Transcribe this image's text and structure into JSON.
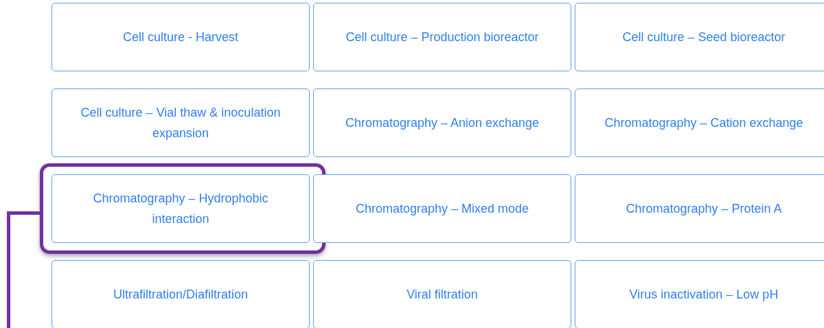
{
  "buttons": [
    {
      "label": "Cell culture - Harvest",
      "highlighted": false
    },
    {
      "label": "Cell culture – Production bioreactor",
      "highlighted": false
    },
    {
      "label": "Cell culture – Seed bioreactor",
      "highlighted": false
    },
    {
      "label": "Cell culture – Vial thaw & inoculation expansion",
      "highlighted": false
    },
    {
      "label": "Chromatography – Anion exchange",
      "highlighted": false
    },
    {
      "label": "Chromatography – Cation exchange",
      "highlighted": false
    },
    {
      "label": "Chromatography – Hydrophobic interaction",
      "highlighted": true
    },
    {
      "label": "Chromatography – Mixed mode",
      "highlighted": false
    },
    {
      "label": "Chromatography – Protein A",
      "highlighted": false
    },
    {
      "label": "Ultrafiltration/Diafiltration",
      "highlighted": false
    },
    {
      "label": "Viral filtration",
      "highlighted": false
    },
    {
      "label": "Virus inactivation – Low pH",
      "highlighted": false
    }
  ]
}
